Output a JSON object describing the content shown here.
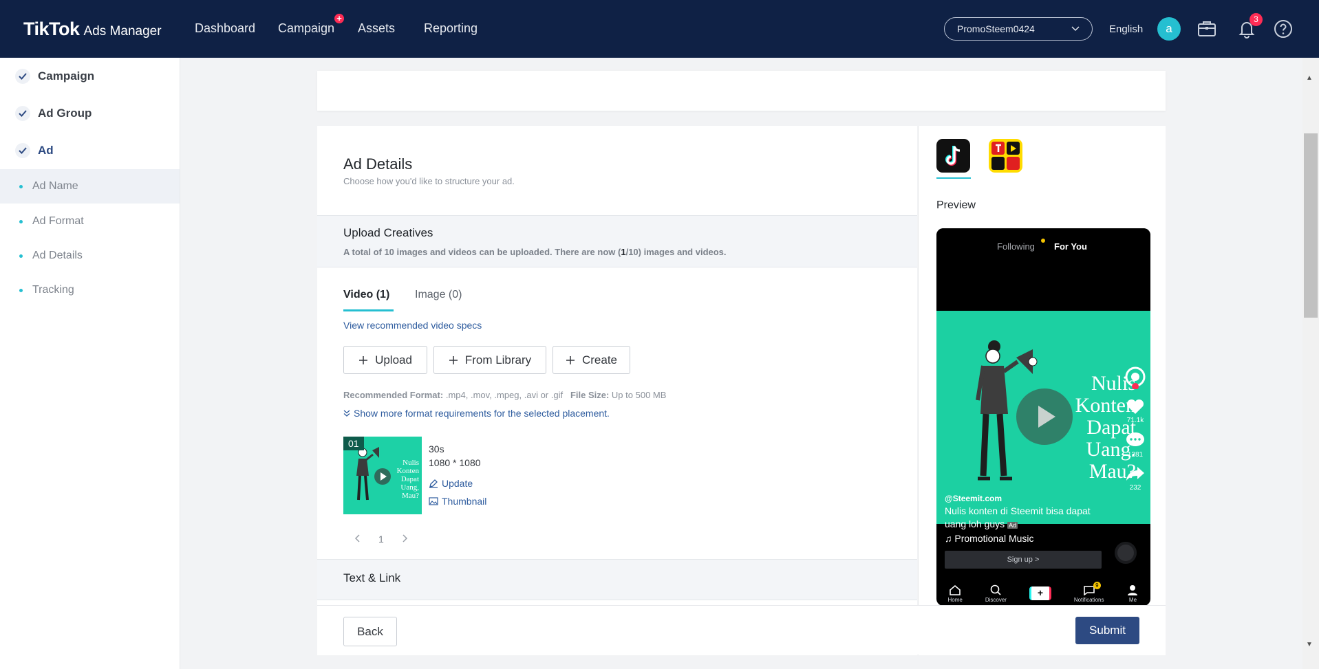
{
  "brand": {
    "logo": "TikTok",
    "logo_sub": "Ads Manager"
  },
  "nav": {
    "items": [
      {
        "label": "Dashboard"
      },
      {
        "label": "Campaign",
        "badge": "+"
      },
      {
        "label": "Assets"
      },
      {
        "label": "Reporting"
      }
    ]
  },
  "account": {
    "selected": "PromoSteem0424"
  },
  "language": "English",
  "avatar_letter": "a",
  "notifications_count": "3",
  "sidebar": {
    "steps": [
      {
        "label": "Campaign",
        "state": "done"
      },
      {
        "label": "Ad Group",
        "state": "done"
      },
      {
        "label": "Ad",
        "state": "active"
      }
    ],
    "subitems": [
      {
        "label": "Ad Name",
        "selected": true
      },
      {
        "label": "Ad Format"
      },
      {
        "label": "Ad Details"
      },
      {
        "label": "Tracking"
      }
    ]
  },
  "ad_details": {
    "title": "Ad Details",
    "description": "Choose how you'd like to structure your ad."
  },
  "upload": {
    "title": "Upload Creatives",
    "desc_pre": "A total of 10 images and videos can be uploaded. There are now (",
    "desc_count": "1",
    "desc_post": "/10) images and videos.",
    "tabs": [
      {
        "label": "Video (1)"
      },
      {
        "label": "Image (0)"
      }
    ],
    "specs_link": "View recommended video specs",
    "buttons": {
      "upload": "Upload",
      "library": "From Library",
      "create": "Create"
    },
    "format_label": "Recommended Format:",
    "format_value": ".mp4, .mov, .mpeg, .avi or .gif",
    "size_label": "File Size:",
    "size_value": "Up to 500 MB",
    "more_link": "Show more format requirements for the selected placement.",
    "video": {
      "index": "01",
      "duration": "30s",
      "resolution": "1080 * 1080",
      "update_label": "Update",
      "thumbnail_label": "Thumbnail",
      "overlay_text": "Nulis Konten Dapat Uang, Mau?"
    },
    "pagination": {
      "current": "1"
    }
  },
  "text_link": {
    "title": "Text & Link"
  },
  "actions": {
    "back": "Back",
    "submit": "Submit"
  },
  "preview": {
    "label": "Preview",
    "feed_tabs": {
      "following": "Following",
      "for_you": "For You"
    },
    "video_text": "Nulis Konten Dapat Uang. Mau?",
    "username": "@Steemit.com",
    "caption": "Nulis konten di Steemit bisa dapat uang loh guys",
    "ad_tag": "Ad",
    "music": "Promotional Music",
    "signup": "Sign up >",
    "likes": "71.1k",
    "comments": "1281",
    "shares": "232",
    "nav": [
      "Home",
      "Discover",
      "+",
      "Notifications",
      "Me"
    ],
    "nav_badge": "9"
  },
  "colors": {
    "topbar": "#0f2145",
    "accent": "#25bfd1",
    "primary": "#2d4a82",
    "badge": "#fe2c55",
    "video_bg": "#1cd0a2"
  }
}
